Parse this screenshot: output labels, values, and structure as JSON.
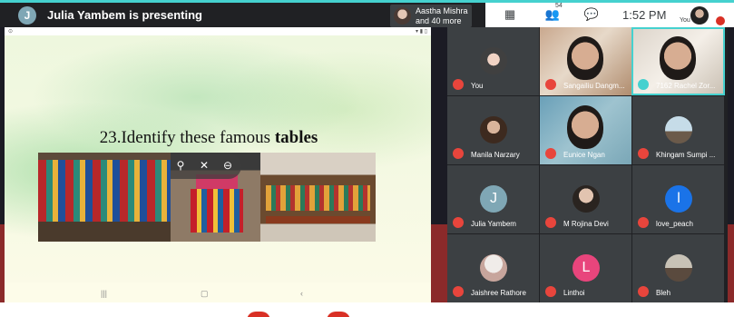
{
  "presenter": {
    "initial": "J",
    "text": "Julia Yambem is presenting"
  },
  "participants_chip": {
    "name": "Aastha Mishra",
    "more": "and 40 more"
  },
  "toolbar": {
    "people_count": "54",
    "clock": "1:52 PM",
    "self_label": "You"
  },
  "slide": {
    "title_prefix": "23.Identify these famous ",
    "title_bold": "tables"
  },
  "tiles": [
    {
      "name": "You",
      "initial": ""
    },
    {
      "name": "Sangailiu Dangm...",
      "initial": ""
    },
    {
      "name": "7162 Rachel Zor...",
      "initial": ""
    },
    {
      "name": "Manila Narzary",
      "initial": ""
    },
    {
      "name": "Eunice Ngan",
      "initial": ""
    },
    {
      "name": "Khingam Sumpi ...",
      "initial": ""
    },
    {
      "name": "Julia Yambem",
      "initial": "J"
    },
    {
      "name": "M Rojina Devi",
      "initial": ""
    },
    {
      "name": "love_peach",
      "initial": "l"
    },
    {
      "name": "Jaishree Rathore",
      "initial": ""
    },
    {
      "name": "Linthoi",
      "initial": "L"
    },
    {
      "name": "Bleh",
      "initial": ""
    }
  ],
  "colors": {
    "accent": "#45d1cf",
    "mute": "#e8453c",
    "avatar_julia": "#7fa7b5",
    "avatar_love_peach": "#1a73e8",
    "avatar_linthoi": "#e8457c"
  }
}
